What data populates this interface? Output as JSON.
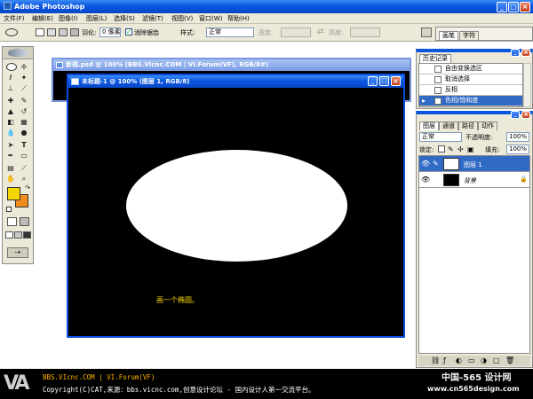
{
  "app": {
    "title": "Adobe Photoshop"
  },
  "menu": [
    "文件(F)",
    "编辑(E)",
    "图像(I)",
    "图层(L)",
    "选择(S)",
    "滤镜(T)",
    "视图(V)",
    "窗口(W)",
    "帮助(H)"
  ],
  "options_bar": {
    "feather_label": "羽化:",
    "feather_value": "0 像素",
    "antialias_label": "消除锯齿",
    "style_label": "样式:",
    "style_value": "正常",
    "width_label": "宽度:",
    "height_label": "高度:",
    "tab_brushes": "画笔",
    "tab_chars": "字符"
  },
  "back_doc": {
    "title": "新视.psd @ 100% (BBS.VIcnc.COM | VI.Forum(VF), RGB/8#)"
  },
  "front_doc": {
    "title": "未标题-1 @ 100% (图层 1, RGB/8)",
    "caption": "画一个椭圆。"
  },
  "history": {
    "tab": "历史记录",
    "items": [
      "自由变换选区",
      "取消选择",
      "反相",
      "色相/饱和度"
    ]
  },
  "layers": {
    "tabs": [
      "图层",
      "通道",
      "路径",
      "动作"
    ],
    "blend": "正常",
    "opacity_label": "不透明度:",
    "opacity_value": "100%",
    "lock_label": "锁定:",
    "fill_label": "填充:",
    "fill_value": "100%",
    "items": [
      "图层 1",
      "背景"
    ]
  },
  "footer": {
    "line1": "BBS.VIcnc.COM | VI.Forum(VF)",
    "line2": "Copyright(C)CAT,来源：bbs.vicnc.com,创意设计论坛 - 国内设计人第一交流平台。",
    "watermark1": "中国-565 设计网",
    "watermark2": "www.cn565design.com"
  },
  "colors": {
    "foreground": "#f5d600",
    "background": "#f28c1e",
    "xp_blue": "#0a56e0"
  }
}
